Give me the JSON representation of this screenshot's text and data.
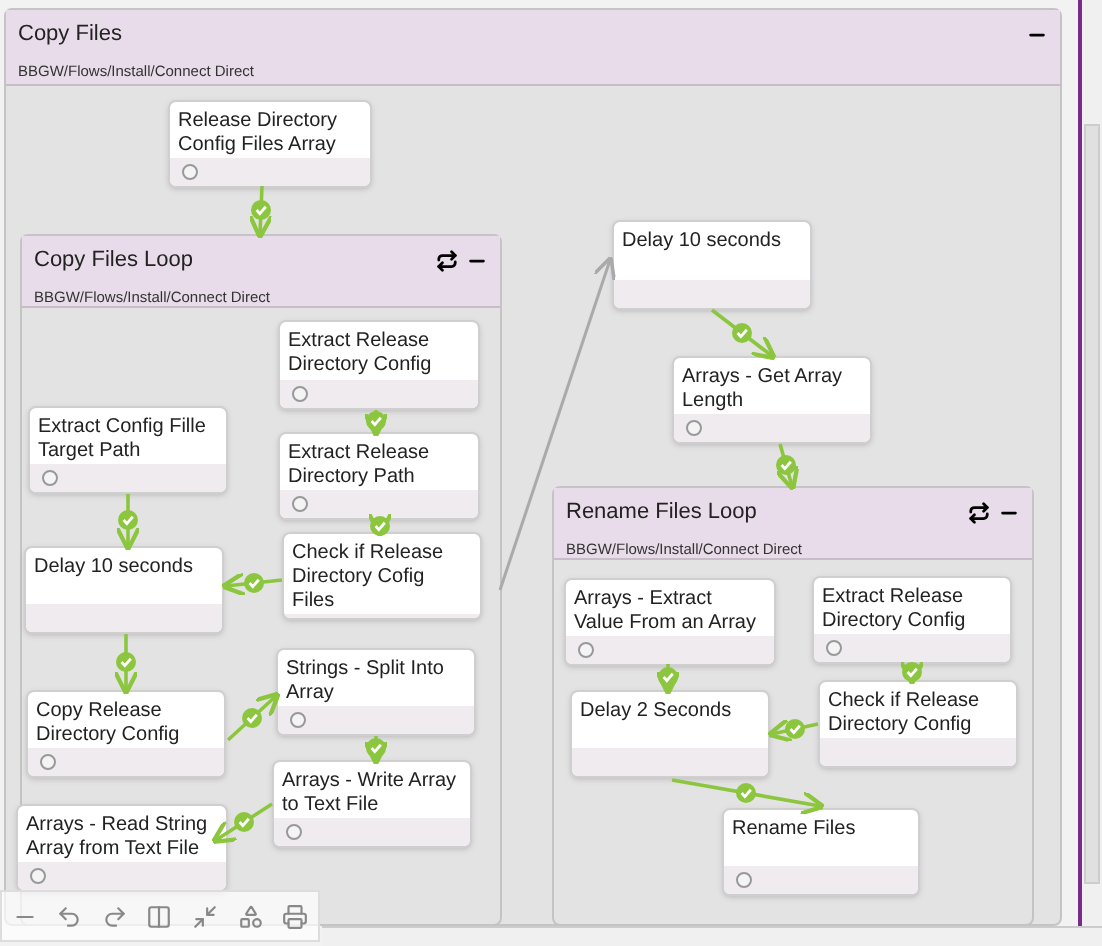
{
  "flow": {
    "title": "Copy Files",
    "path": "BBGW/Flows/Install/Connect Direct",
    "nodes": [
      {
        "label": "Release Directory Config Files Array",
        "status_icon": true
      }
    ],
    "groups": [
      {
        "title": "Copy Files Loop",
        "path": "BBGW/Flows/Install/Connect Direct",
        "nodes": [
          {
            "label": "Extract Release Directory Config",
            "status_icon": true
          },
          {
            "label": "Extract Release Directory Path",
            "status_icon": true
          },
          {
            "label": "Extract Config Fille Target Path",
            "status_icon": true
          },
          {
            "label": "Delay 10 seconds",
            "status_icon": false
          },
          {
            "label": "Check if Release Directory Cofig Files",
            "status_icon": false
          },
          {
            "label": "Copy Release Directory Config",
            "status_icon": true
          },
          {
            "label": "Strings - Split Into Array",
            "status_icon": true
          },
          {
            "label": "Arrays - Write Array to Text File",
            "status_icon": true
          },
          {
            "label": "Arrays - Read String Array from Text File",
            "status_icon": true
          }
        ]
      },
      {
        "title": "Rename Files Loop",
        "path": "BBGW/Flows/Install/Connect Direct",
        "nodes": [
          {
            "label": "Arrays - Extract Value From an Array",
            "status_icon": true
          },
          {
            "label": "Extract Release Directory Config",
            "status_icon": true
          },
          {
            "label": "Delay 2 Seconds",
            "status_icon": false
          },
          {
            "label": "Check if Release Directory Config",
            "status_icon": false
          },
          {
            "label": "Rename Files",
            "status_icon": true
          }
        ]
      }
    ],
    "after_nodes": [
      {
        "label": "Delay 10 seconds",
        "status_icon": false
      },
      {
        "label": "Arrays - Get Array Length",
        "status_icon": true
      }
    ]
  }
}
